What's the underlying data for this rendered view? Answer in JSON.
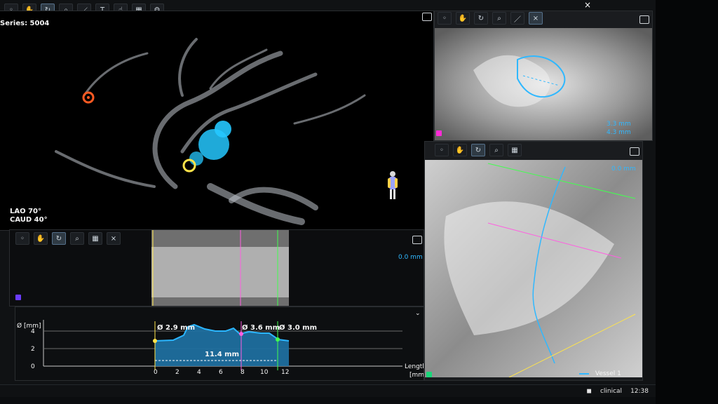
{
  "window": {
    "close_label": "×"
  },
  "panels": {
    "main3d": {
      "series_label": "Series: 5004",
      "lao_label": "LAO 70°",
      "caud_label": "CAUD 40°"
    },
    "top_right": {
      "measure1": "3.3 mm",
      "measure2": "4.3 mm"
    },
    "bottom_right": {
      "offset": "0.0 mm",
      "legend": "Vessel 1"
    },
    "mid_strip": {
      "offset": "0.0 mm"
    },
    "graph": {
      "y_unit": "Ø [mm]",
      "x_label_line1": "Length",
      "x_label_line2": "[mm]",
      "y_ticks": [
        "4",
        "2",
        "0"
      ],
      "x_ticks": [
        "0",
        "2",
        "4",
        "6",
        "8",
        "10",
        "12"
      ],
      "labels": {
        "left": "Ø 2.9 mm",
        "middle": "Ø 3.6 mm",
        "right": "Ø 3.0 mm",
        "length": "11.4 mm"
      }
    }
  },
  "taskbar": {
    "user": "clinical",
    "time": "12:38"
  },
  "colors": {
    "accent_cyan": "#30b8ff",
    "marker_yellow": "#ffe44a",
    "marker_pink": "#ff5fe1",
    "marker_green": "#42ff4f",
    "orange_marker": "#ff5a22",
    "purple_swatch": "#6b3cff",
    "green_swatch": "#1ad67a"
  }
}
